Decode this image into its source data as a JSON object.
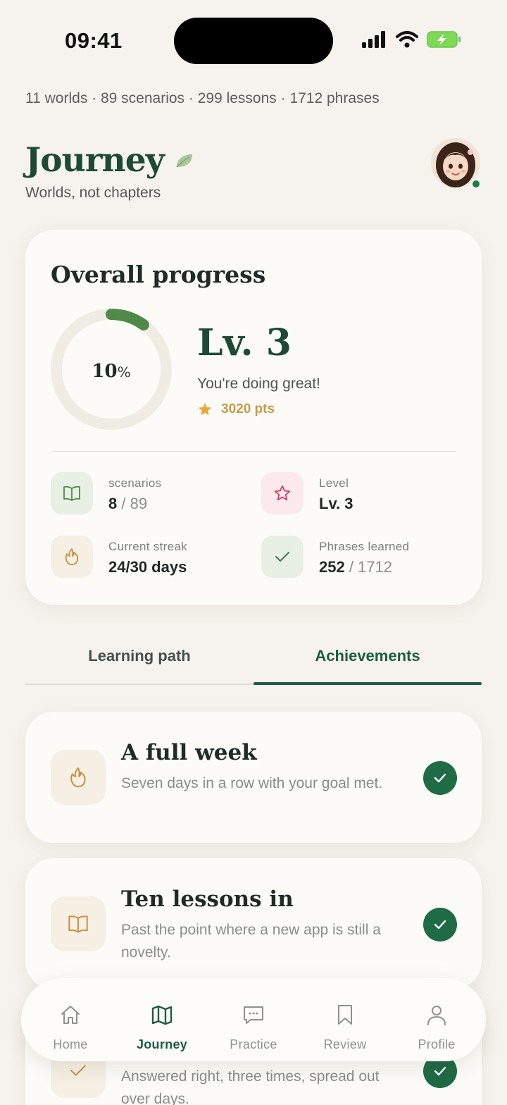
{
  "status_bar": {
    "time": "09:41"
  },
  "stats_line": "11 worlds · 89 scenarios · 299 lessons · 1712 phrases",
  "header": {
    "title": "Journey",
    "subtitle": "Worlds, not chapters"
  },
  "overall_progress": {
    "title": "Overall progress",
    "percent": 10,
    "percent_number": "10",
    "percent_sign": "%",
    "level": "Lv. 3",
    "message": "You're doing great!",
    "points": "3020 pts",
    "stats": [
      {
        "label": "scenarios",
        "value": "8",
        "total": " / 89"
      },
      {
        "label": "Level",
        "value": "Lv. 3"
      },
      {
        "label": "Current streak",
        "value": "24/30 days"
      },
      {
        "label": "Phrases learned",
        "value": "252",
        "total": " / 1712"
      }
    ]
  },
  "tabs": {
    "learning_path": "Learning path",
    "achievements": "Achievements",
    "active": "achievements"
  },
  "achievements": [
    {
      "title": "A full week",
      "description": "Seven days in a row with your goal met.",
      "icon": "flame-icon",
      "completed": true
    },
    {
      "title": "Ten lessons in",
      "description": "Past the point where a new app is still a novelty.",
      "icon": "book-icon",
      "completed": true
    },
    {
      "title": "",
      "description": "Answered right, three times, spread out over days.",
      "icon": "check-icon",
      "completed": true
    }
  ],
  "nav": [
    {
      "label": "Home",
      "icon": "home-icon"
    },
    {
      "label": "Journey",
      "icon": "map-icon",
      "active": true
    },
    {
      "label": "Practice",
      "icon": "chat-icon"
    },
    {
      "label": "Review",
      "icon": "bookmark-icon"
    },
    {
      "label": "Profile",
      "icon": "person-icon"
    }
  ],
  "colors": {
    "accent": "#1d5c40",
    "gold": "#c99a4a",
    "background": "#f6f3ee"
  }
}
